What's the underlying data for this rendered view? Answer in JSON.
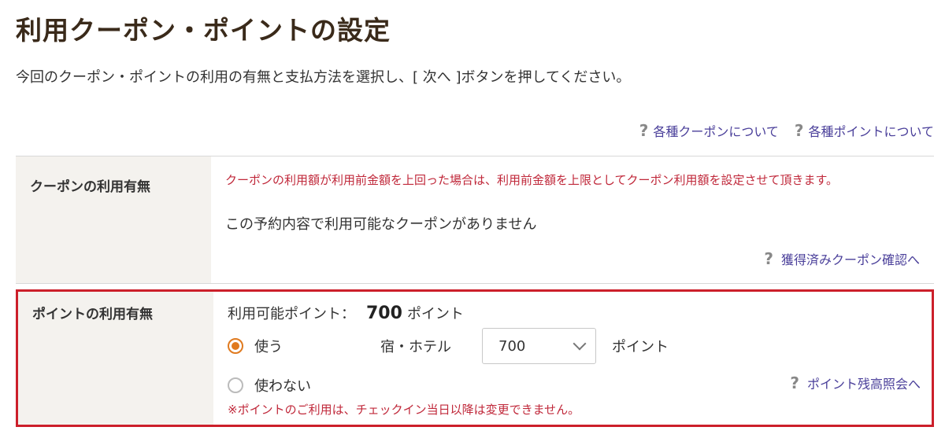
{
  "page": {
    "title": "利用クーポン・ポイントの設定",
    "lead": "今回のクーポン・ポイントの利用の有無と支払方法を選択し、[ 次へ ]ボタンを押してください。"
  },
  "help_links": {
    "coupon_about": "各種クーポンについて",
    "point_about": "各種ポイントについて",
    "icon": "?"
  },
  "coupon": {
    "label": "クーポンの利用有無",
    "notice": "クーポンの利用額が利用前金額を上回った場合は、利用前金額を上限としてクーポン利用額を設定させて頂きます。",
    "none_message": "この予約内容で利用可能なクーポンがありません",
    "confirm_link": "獲得済みクーポン確認へ"
  },
  "point": {
    "label": "ポイントの利用有無",
    "available_label": "利用可能ポイント：",
    "available_value": "700",
    "available_unit": "ポイント",
    "use_label": "使う",
    "no_use_label": "使わない",
    "hotel_label": "宿・ホテル",
    "selected_value": "700",
    "unit_label": "ポイント",
    "balance_link": "ポイント残高照会へ",
    "note": "※ポイントのご利用は、チェックイン当日以降は変更できません。",
    "selected_option": "use"
  },
  "colors": {
    "title": "#3a2a1a",
    "link": "#4a3f9a",
    "alert": "#c0283a",
    "highlight_border": "#cc1f2a",
    "radio_accent": "#e07a1f",
    "label_bg": "#f4f2ee"
  }
}
